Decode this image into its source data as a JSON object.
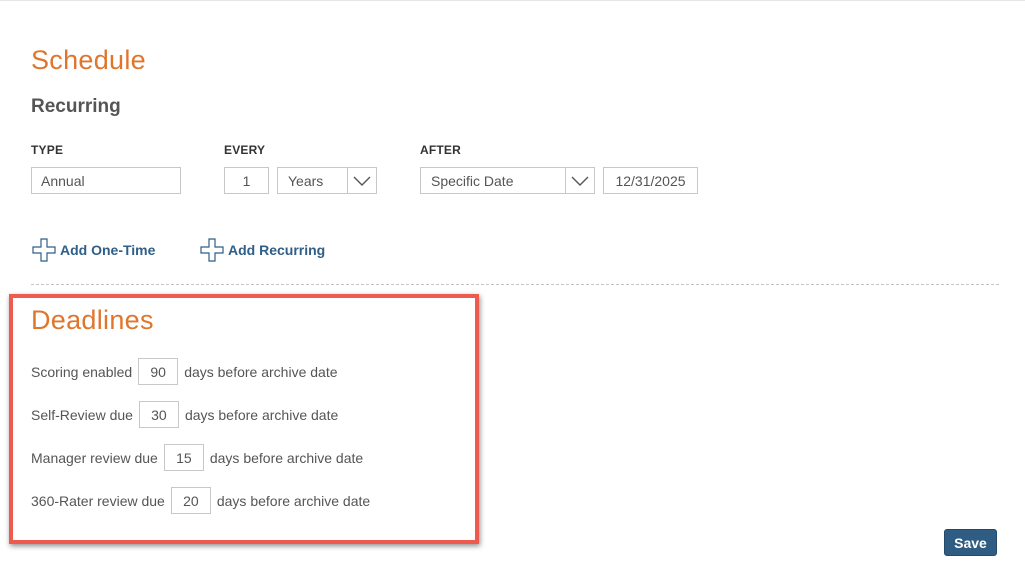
{
  "schedule": {
    "title": "Schedule",
    "recurring_title": "Recurring",
    "labels": {
      "type": "TYPE",
      "every": "EVERY",
      "after": "AFTER"
    },
    "type_value": "Annual",
    "every_count": "1",
    "every_unit": "Years",
    "after_option": "Specific Date",
    "after_date": "12/31/2025",
    "add_one_time": "Add One-Time",
    "add_recurring": "Add Recurring"
  },
  "deadlines": {
    "title": "Deadlines",
    "rows": [
      {
        "label": "Scoring enabled",
        "days": "90",
        "suffix": "days before archive date"
      },
      {
        "label": "Self-Review due",
        "days": "30",
        "suffix": "days before archive date"
      },
      {
        "label": "Manager review due",
        "days": "15",
        "suffix": "days before archive date"
      },
      {
        "label": "360-Rater review due",
        "days": "20",
        "suffix": "days before archive date"
      }
    ]
  },
  "save_label": "Save",
  "colors": {
    "heading_accent": "#e0752d",
    "link": "#2f5e88",
    "highlight_border": "#ee5a4e",
    "save_button": "#2f5c82"
  },
  "icons": {
    "add": "plus-icon",
    "dropdown": "chevron-down-icon"
  }
}
